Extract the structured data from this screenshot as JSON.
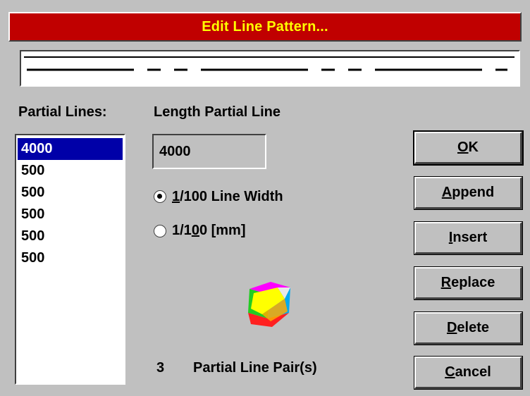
{
  "dialog": {
    "title": "Edit Line Pattern..."
  },
  "labels": {
    "partial_lines": "Partial Lines:",
    "length_partial_line": "Length Partial Line"
  },
  "list": {
    "items": [
      "4000",
      "500",
      "500",
      "500",
      "500",
      "500"
    ],
    "selected_index": 0
  },
  "length_field": {
    "value": "4000"
  },
  "units": {
    "option_1": {
      "prefix": "",
      "mnemonic": "1",
      "rest": "/100 Line Width",
      "checked": true
    },
    "option_2": {
      "prefix": "1/1",
      "mnemonic": "0",
      "rest": "0 [mm]",
      "checked": false
    }
  },
  "pairs": {
    "count": "3",
    "label": "Partial Line Pair(s)"
  },
  "buttons": {
    "ok": {
      "mnemonic": "O",
      "rest": "K"
    },
    "append": {
      "mnemonic": "A",
      "rest": "ppend"
    },
    "insert": {
      "mnemonic": "I",
      "rest": "nsert"
    },
    "replace": {
      "mnemonic": "R",
      "rest": "eplace"
    },
    "delete": {
      "mnemonic": "D",
      "rest": "elete"
    },
    "cancel": {
      "mnemonic": "C",
      "rest": "ancel"
    }
  },
  "pattern": {
    "segments": [
      4000,
      500,
      500,
      500,
      500,
      500
    ]
  },
  "colors": {
    "titlebar": "#c00000",
    "title_text": "#ffff00",
    "selection": "#0000a8",
    "face": "#c0c0c0"
  },
  "icons": {
    "preview_cube": "colorful-cube-icon"
  }
}
